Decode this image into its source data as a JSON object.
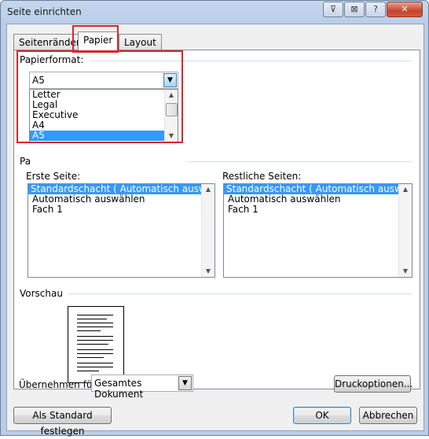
{
  "window": {
    "title": "Seite einrichten"
  },
  "titlebar": {
    "min": "⊽",
    "max": "⊠",
    "help": "?",
    "close": "✕"
  },
  "tabs": [
    {
      "label": "Seitenränder"
    },
    {
      "label": "Papier"
    },
    {
      "label": "Layout"
    }
  ],
  "paper_format": {
    "label": "Papierformat:",
    "selected": "A5",
    "options": [
      "Letter",
      "Legal",
      "Executive",
      "A4",
      "A5"
    ]
  },
  "paper_source": {
    "label_partial": "Pa",
    "first_page": {
      "label": "Erste Seite:",
      "items": [
        "Standardschacht ( Automatisch auswählen)",
        "Automatisch auswählen",
        "Fach 1"
      ]
    },
    "other_pages": {
      "label": "Restliche Seiten:",
      "items": [
        "Standardschacht ( Automatisch auswählen)",
        "Automatisch auswählen",
        "Fach 1"
      ]
    }
  },
  "preview": {
    "label": "Vorschau"
  },
  "apply_to": {
    "label": "Übernehmen für:",
    "value": "Gesamtes Dokument"
  },
  "buttons": {
    "print_options": "Druckoptionen...",
    "set_default": "Als Standard festlegen",
    "ok": "OK",
    "cancel": "Abbrechen"
  },
  "colors": {
    "highlight": "#d9262c",
    "selection": "#3399ff"
  }
}
